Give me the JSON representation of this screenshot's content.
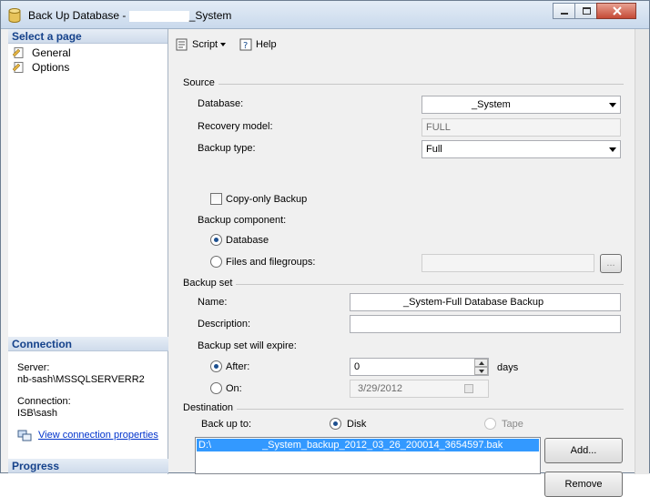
{
  "window": {
    "title_prefix": "Back Up Database - ",
    "title_suffix": "_System"
  },
  "sidebar": {
    "select_page_header": "Select a page",
    "items": [
      {
        "label": "General",
        "icon": "page-icon"
      },
      {
        "label": "Options",
        "icon": "page-icon"
      }
    ],
    "connection_header": "Connection",
    "server_label": "Server:",
    "server_value": "nb-sash\\MSSQLSERVERR2",
    "connection_label": "Connection:",
    "connection_value": "ISB\\sash",
    "view_link": "View connection properties",
    "progress_header": "Progress"
  },
  "toolbar": {
    "script_label": "Script",
    "help_label": "Help"
  },
  "source": {
    "header": "Source",
    "database_label": "Database:",
    "database_value": "_System",
    "recovery_label": "Recovery model:",
    "recovery_value": "FULL",
    "backup_type_label": "Backup type:",
    "backup_type_value": "Full",
    "copy_only_label": "Copy-only Backup",
    "component_label": "Backup component:",
    "database_radio_label": "Database",
    "files_radio_label": "Files and filegroups:",
    "browse_label": "..."
  },
  "backup_set": {
    "header": "Backup set",
    "name_label": "Name:",
    "name_value": "_System-Full Database Backup",
    "description_label": "Description:",
    "description_value": "",
    "expire_label": "Backup set will expire:",
    "after_label": "After:",
    "after_value": "0",
    "days_label": "days",
    "on_label": "On:",
    "on_value": "3/29/2012"
  },
  "destination": {
    "header": "Destination",
    "backup_to_label": "Back up to:",
    "disk_label": "Disk",
    "tape_label": "Tape",
    "path_prefix": "D:\\",
    "path_value": "_System_backup_2012_03_26_200014_3654597.bak",
    "add_label": "Add...",
    "remove_label": "Remove"
  },
  "colors": {
    "accent": "#15428b",
    "selection": "#3399ff",
    "link": "#0033cc"
  }
}
